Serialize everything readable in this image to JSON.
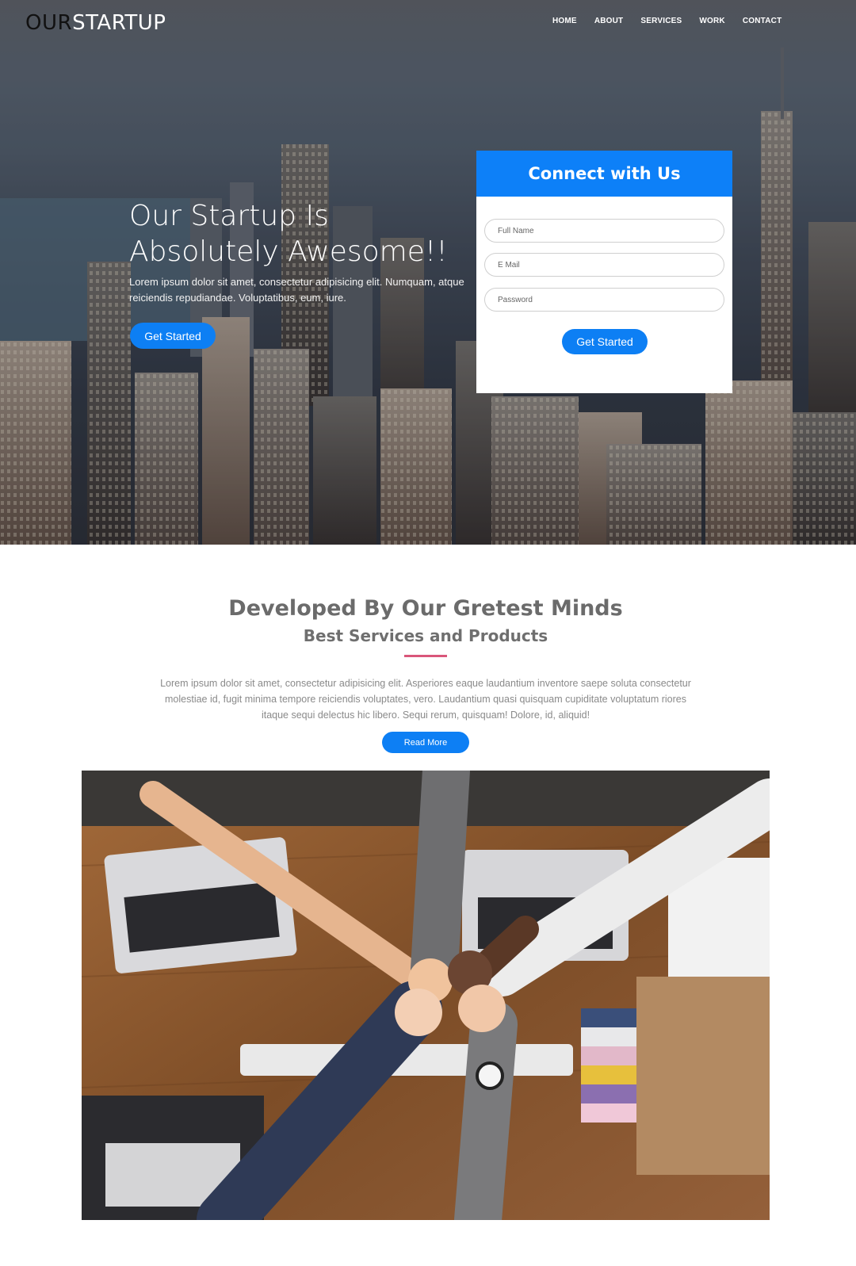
{
  "header": {
    "logo_dark": "OUR",
    "logo_light": "STARTUP",
    "nav": [
      "HOME",
      "ABOUT",
      "SERVICES",
      "WORK",
      "CONTACT"
    ]
  },
  "hero": {
    "title": "Our Startup Is Absolutely Awesome!!",
    "text": "Lorem ipsum dolor sit amet, consectetur adipisicing elit. Numquam, atque reiciendis repudiandae. Voluptatibus, eum, iure.",
    "button": "Get Started"
  },
  "form": {
    "title": "Connect with Us",
    "fields": [
      {
        "placeholder": "Full Name"
      },
      {
        "placeholder": "E Mail"
      },
      {
        "placeholder": "Password"
      }
    ],
    "button": "Get Started"
  },
  "section": {
    "title": "Developed By Our Gretest Minds",
    "subtitle": "Best Services and Products",
    "text": "Lorem ipsum dolor sit amet, consectetur adipisicing elit. Asperiores eaque laudantium inventore saepe soluta consectetur molestiae id, fugit minima tempore reiciendis voluptates, vero. Laudantium quasi quisquam cupiditate voluptatum riores itaque sequi delectus hic libero. Sequi rerum, quisquam! Dolore, id, aliquid!",
    "button": "Read More"
  },
  "colors": {
    "accent": "#0d7ff4",
    "divider": "#d9567a"
  }
}
